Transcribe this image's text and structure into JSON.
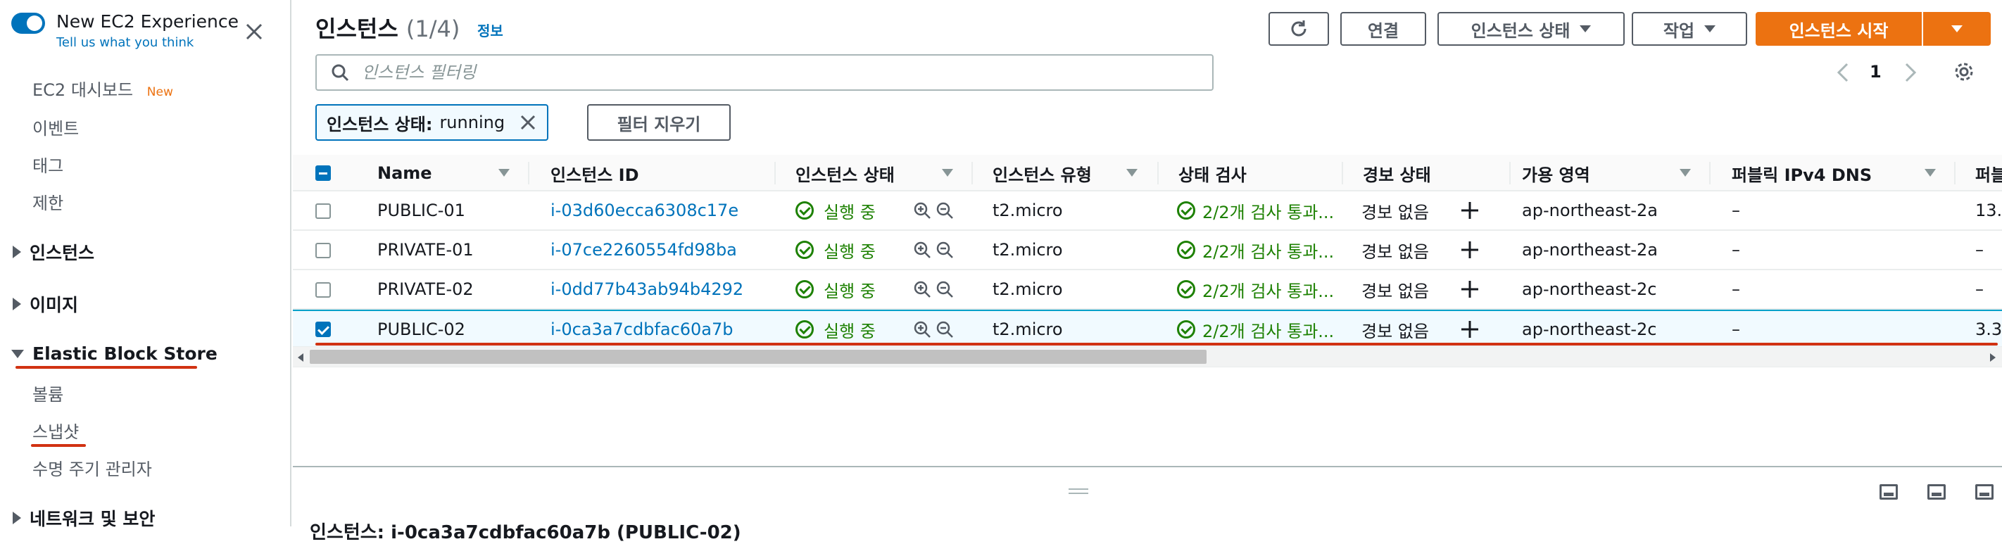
{
  "sidebar": {
    "experience_title": "New EC2 Experience",
    "experience_sub": "Tell us what you think",
    "items": [
      {
        "label": "EC2 대시보드",
        "badge": "New"
      },
      {
        "label": "이벤트"
      },
      {
        "label": "태그"
      },
      {
        "label": "제한"
      }
    ],
    "sections": {
      "instances": "인스턴스",
      "images": "이미지",
      "ebs": "Elastic Block Store",
      "network": "네트워크 및 보안"
    },
    "ebs_items": [
      "볼륨",
      "스냅샷",
      "수명 주기 관리자"
    ]
  },
  "header": {
    "title": "인스턴스",
    "count": "(1/4)",
    "info": "정보",
    "connect": "연결",
    "instance_state": "인스턴스 상태",
    "actions": "작업",
    "launch": "인스턴스 시작"
  },
  "search": {
    "placeholder": "인스턴스 필터링"
  },
  "filter": {
    "key": "인스턴스 상태:",
    "value": "running",
    "clear": "필터 지우기"
  },
  "pagination": {
    "page": "1"
  },
  "table": {
    "columns": [
      "Name",
      "인스턴스 ID",
      "인스턴스 상태",
      "인스턴스 유형",
      "상태 검사",
      "경보 상태",
      "가용 영역",
      "퍼블릭 IPv4 DNS",
      "퍼블"
    ],
    "rows": [
      {
        "name": "PUBLIC-01",
        "id": "i-03d60ecca6308c17e",
        "state": "실행 중",
        "type": "t2.micro",
        "check": "2/2개 검사 통과...",
        "alarm": "경보 없음",
        "az": "ap-northeast-2a",
        "dns": "–",
        "ip": "13."
      },
      {
        "name": "PRIVATE-01",
        "id": "i-07ce2260554fd98ba",
        "state": "실행 중",
        "type": "t2.micro",
        "check": "2/2개 검사 통과...",
        "alarm": "경보 없음",
        "az": "ap-northeast-2a",
        "dns": "–",
        "ip": "–"
      },
      {
        "name": "PRIVATE-02",
        "id": "i-0dd77b43ab94b4292",
        "state": "실행 중",
        "type": "t2.micro",
        "check": "2/2개 검사 통과...",
        "alarm": "경보 없음",
        "az": "ap-northeast-2c",
        "dns": "–",
        "ip": "–"
      },
      {
        "name": "PUBLIC-02",
        "id": "i-0ca3a7cdbfac60a7b",
        "state": "실행 중",
        "type": "t2.micro",
        "check": "2/2개 검사 통과...",
        "alarm": "경보 없음",
        "az": "ap-northeast-2c",
        "dns": "–",
        "ip": "3.3"
      }
    ]
  },
  "bottom": {
    "details": "인스턴스: i-0ca3a7cdbfac60a7b (PUBLIC-02)"
  },
  "colors": {
    "primary": "#ec7211",
    "link": "#0073bb",
    "success": "#1d8102",
    "underline": "#d13212"
  }
}
